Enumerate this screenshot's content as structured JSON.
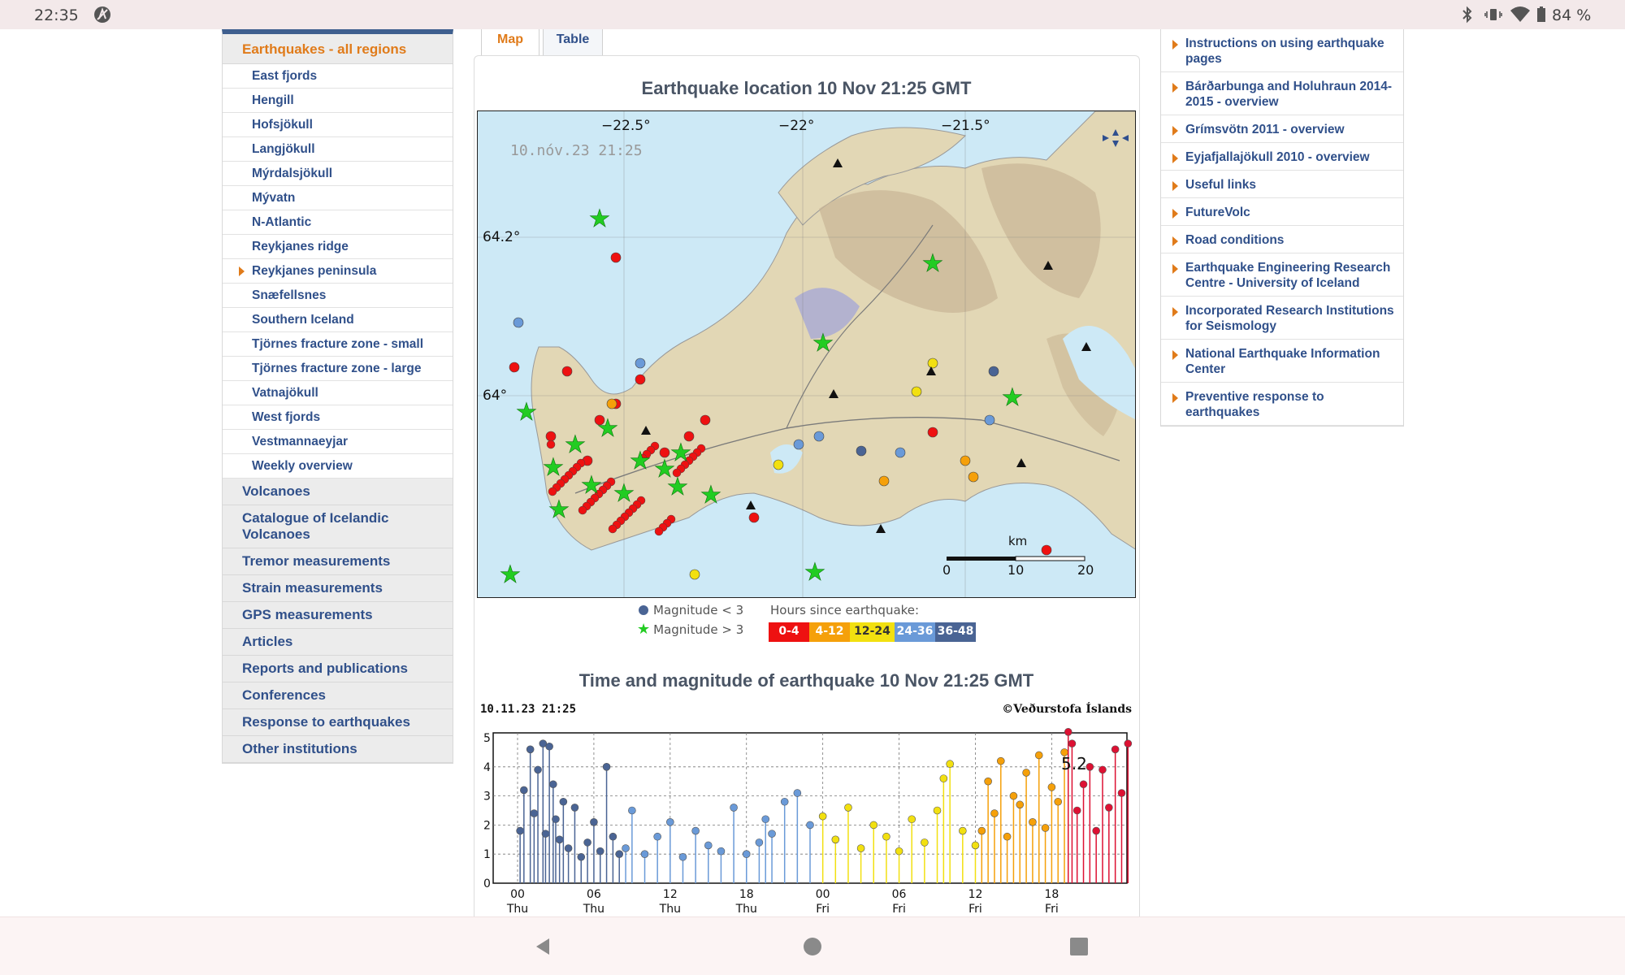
{
  "status_bar": {
    "time": "22:35",
    "battery": "84 %"
  },
  "left_menu": {
    "top_item": "Earthquakes - all regions",
    "sub_items": [
      {
        "label": "East fjords",
        "active": false
      },
      {
        "label": "Hengill",
        "active": false
      },
      {
        "label": "Hofsjökull",
        "active": false
      },
      {
        "label": "Langjökull",
        "active": false
      },
      {
        "label": "Mýrdalsjökull",
        "active": false
      },
      {
        "label": "Mývatn",
        "active": false
      },
      {
        "label": "N-Atlantic",
        "active": false
      },
      {
        "label": "Reykjanes ridge",
        "active": false
      },
      {
        "label": "Reykjanes peninsula",
        "active": true
      },
      {
        "label": "Snæfellsnes",
        "active": false
      },
      {
        "label": "Southern Iceland",
        "active": false
      },
      {
        "label": "Tjörnes fracture zone - small",
        "active": false
      },
      {
        "label": "Tjörnes fracture zone - large",
        "active": false
      },
      {
        "label": "Vatnajökull",
        "active": false
      },
      {
        "label": "West fjords",
        "active": false
      },
      {
        "label": "Vestmannaeyjar",
        "active": false
      },
      {
        "label": "Weekly overview",
        "active": false
      }
    ],
    "main_items": [
      "Volcanoes",
      "Catalogue of Icelandic Volcanoes",
      "Tremor measurements",
      "Strain measurements",
      "GPS measurements",
      "Articles",
      "Reports and publications",
      "Conferences",
      "Response to earthquakes",
      "Other institutions"
    ]
  },
  "tabs": [
    {
      "label": "Map",
      "active": true
    },
    {
      "label": "Table",
      "active": false
    }
  ],
  "map_section": {
    "heading": "Earthquake location   10 Nov 21:25 GMT",
    "stamp": "10.nóv.23  21:25",
    "lon_labels": [
      "−22.5°",
      "−22°",
      "−21.5°"
    ],
    "lat_labels": [
      "64.2°",
      "64°"
    ],
    "scale_unit": "km",
    "scale_ticks": [
      "0",
      "10",
      "20"
    ],
    "legend_small": "Magnitude < 3",
    "legend_large": "Magnitude > 3",
    "hours_title": "Hours since earthquake:",
    "hours_bins": [
      {
        "label": "0-4",
        "color": "#ee1111"
      },
      {
        "label": "4-12",
        "color": "#f5a00a"
      },
      {
        "label": "12-24",
        "color": "#f2e010"
      },
      {
        "label": "24-36",
        "color": "#6a9ad8"
      },
      {
        "label": "36-48",
        "color": "#4a6494"
      }
    ]
  },
  "chart_section": {
    "heading": "Time and magnitude of earthquake   10 Nov 21:25 GMT",
    "stamp": "10.11.23  21:25",
    "credit": "©Veðurstofa Íslands",
    "peak_label": "5.2",
    "chart_data": {
      "type": "scatter",
      "xlabel": "",
      "ylabel": "",
      "ylim": [
        0,
        5
      ],
      "y_ticks": [
        "0",
        "1",
        "2",
        "3",
        "4",
        "5"
      ],
      "x_ticks": [
        {
          "hour": "00",
          "day": "Thu"
        },
        {
          "hour": "06",
          "day": "Thu"
        },
        {
          "hour": "12",
          "day": "Thu"
        },
        {
          "hour": "18",
          "day": "Thu"
        },
        {
          "hour": "00",
          "day": "Fri"
        },
        {
          "hour": "06",
          "day": "Fri"
        },
        {
          "hour": "12",
          "day": "Fri"
        },
        {
          "hour": "18",
          "day": "Fri"
        }
      ],
      "series": [
        {
          "color": "#4a6494",
          "x": [
            0.2,
            0.5,
            1,
            1.3,
            1.6,
            2,
            2.2,
            2.5,
            2.8,
            3,
            3.3,
            3.6,
            4,
            4.5,
            5,
            5.5,
            6,
            6.5,
            7,
            7.5,
            8
          ],
          "y": [
            1.8,
            3.2,
            4.6,
            2.4,
            3.9,
            4.8,
            1.7,
            4.7,
            3.4,
            2.2,
            1.5,
            2.8,
            1.2,
            2.6,
            0.9,
            1.4,
            2.1,
            1.1,
            4.0,
            1.6,
            1.0
          ]
        },
        {
          "color": "#6a9ad8",
          "x": [
            8.5,
            9,
            10,
            11,
            12,
            13,
            14,
            15,
            16,
            17,
            18,
            19,
            19.5,
            20,
            21,
            22,
            23
          ],
          "y": [
            1.2,
            2.5,
            1.0,
            1.6,
            2.1,
            0.9,
            1.8,
            1.3,
            1.1,
            2.6,
            1.0,
            1.4,
            2.2,
            1.7,
            2.8,
            3.1,
            2.0
          ]
        },
        {
          "color": "#f2e010",
          "x": [
            24,
            25,
            26,
            27,
            28,
            29,
            30,
            31,
            32,
            33,
            33.5,
            34,
            35,
            36
          ],
          "y": [
            2.3,
            1.5,
            2.6,
            1.2,
            2.0,
            1.6,
            1.1,
            2.2,
            1.4,
            2.5,
            3.6,
            4.1,
            1.8,
            1.3
          ]
        },
        {
          "color": "#f5a00a",
          "x": [
            36.5,
            37,
            37.5,
            38,
            38.5,
            39,
            39.5,
            40,
            40.5,
            41,
            41.5,
            42,
            42.5,
            43
          ],
          "y": [
            1.8,
            3.5,
            2.4,
            4.2,
            1.6,
            3.0,
            2.7,
            3.8,
            2.1,
            4.4,
            1.9,
            3.3,
            2.8,
            4.5
          ]
        },
        {
          "color": "#dd1133",
          "x": [
            43.3,
            43.6,
            44,
            44.5,
            45,
            45.5,
            46,
            46.5,
            47,
            47.5,
            48
          ],
          "y": [
            5.2,
            4.8,
            2.5,
            3.4,
            4.0,
            1.8,
            3.9,
            2.6,
            4.6,
            3.1,
            4.8
          ]
        }
      ]
    }
  },
  "right_menu": [
    "Instructions on using earthquake pages",
    "Bárðarbunga and Holuhraun 2014-2015 - overview",
    "Grímsvötn 2011 - overview",
    "Eyjafjallajökull 2010 - overview",
    "Useful links",
    "FutureVolc",
    "Road conditions",
    "Earthquake Engineering Research Centre - University of Iceland",
    "Incorporated Research Institutions for Seismology",
    "National Earthquake Information Center",
    "Preventive response to earthquakes"
  ]
}
